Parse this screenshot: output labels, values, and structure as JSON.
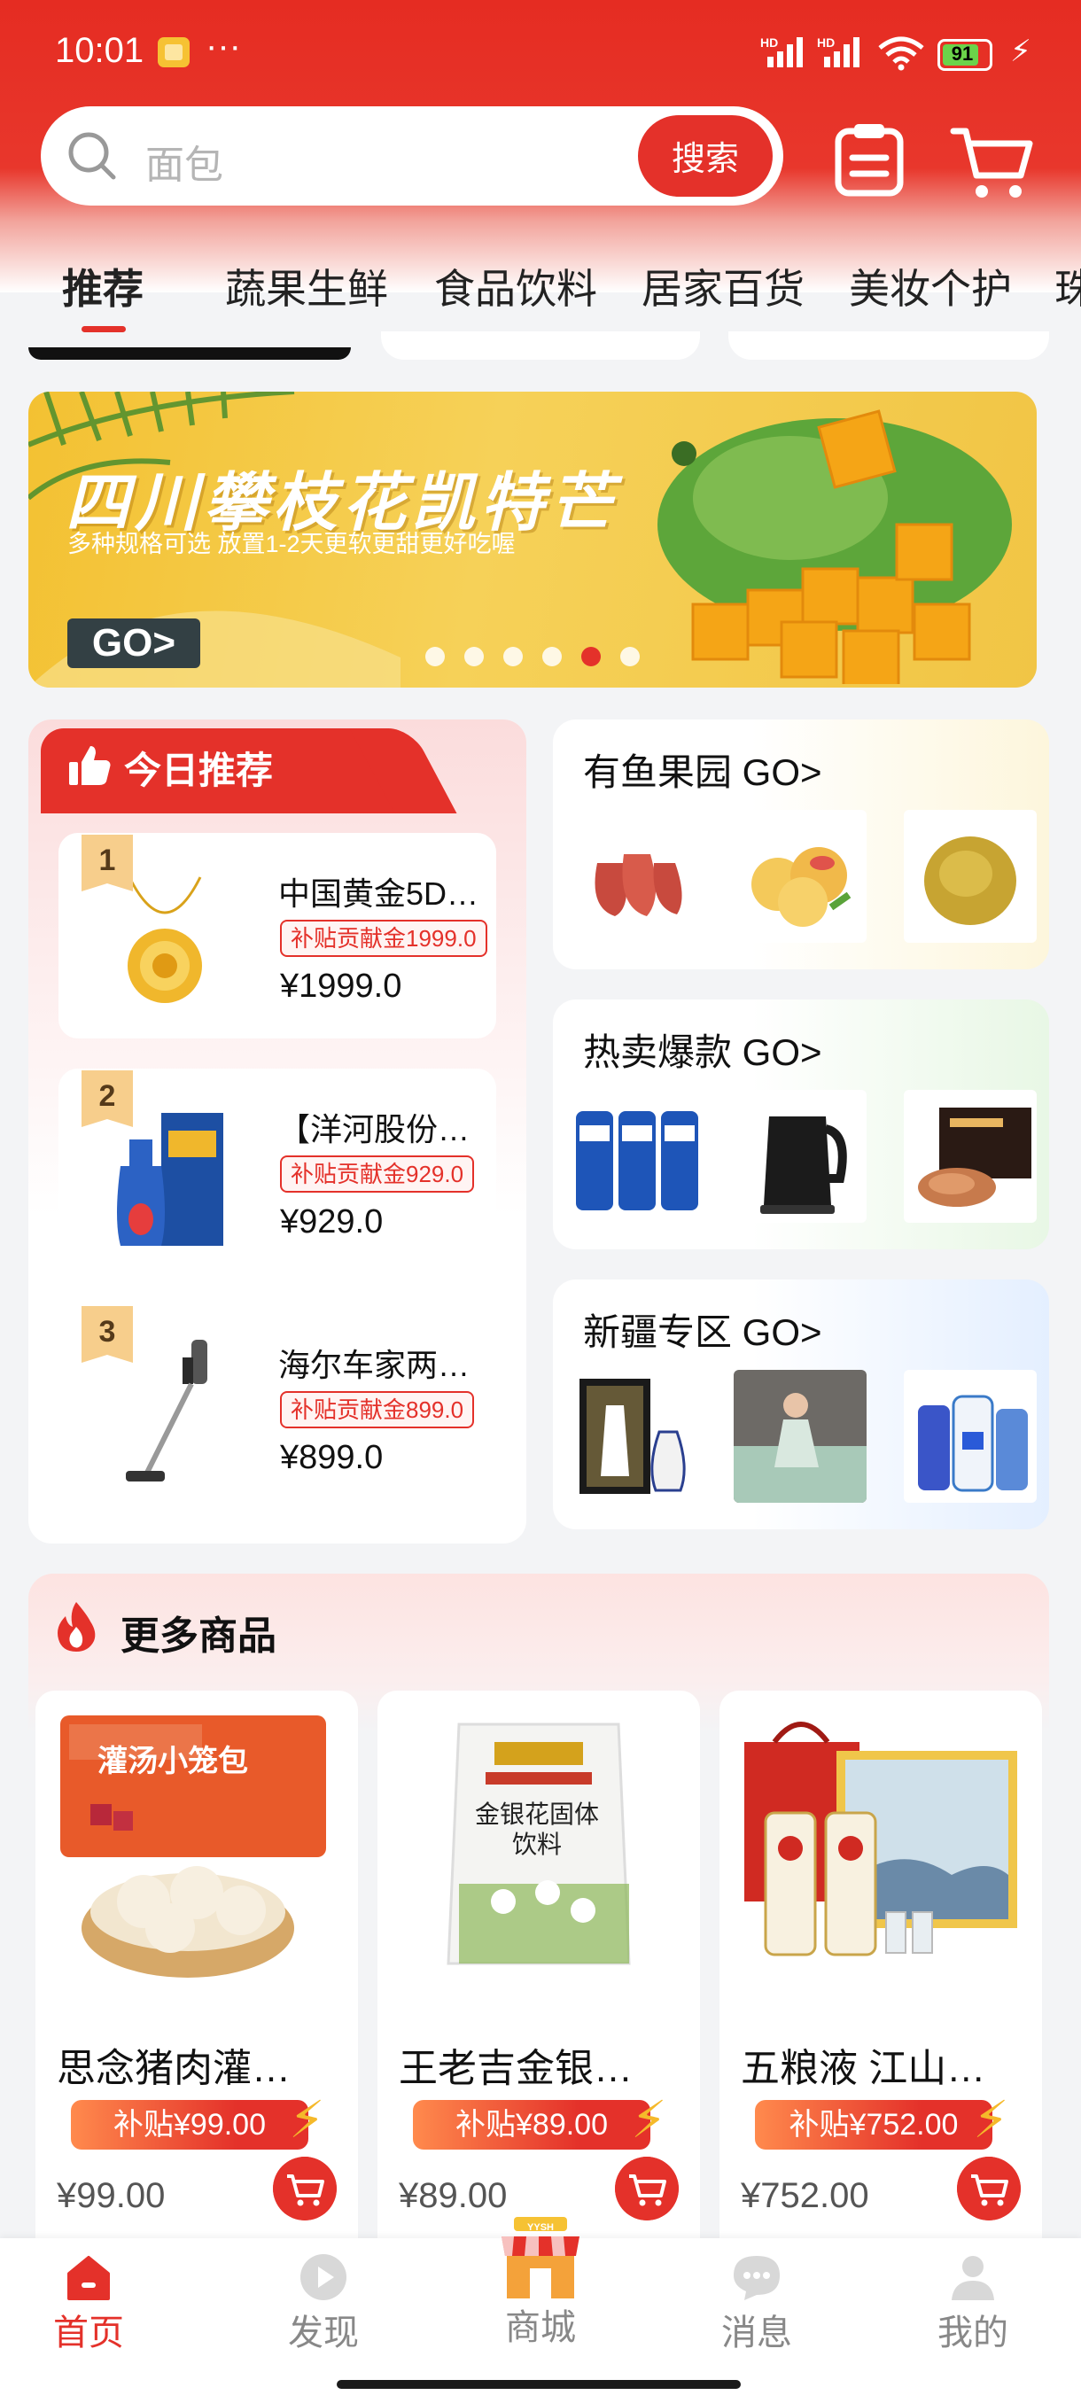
{
  "status_bar": {
    "time": "10:01",
    "dots": "···",
    "hd1": "HD",
    "hd2": "HD",
    "battery": "91"
  },
  "search": {
    "placeholder": "面包",
    "button_label": "搜索"
  },
  "categories": [
    "推荐",
    "蔬果生鲜",
    "食品饮料",
    "居家百货",
    "美妆个护",
    "珠"
  ],
  "banner": {
    "title": "四川攀枝花凯特芒",
    "subtitle": "多种规格可选 放置1-2天更软更甜更好吃喔",
    "go_label": "GO>",
    "slide_count": 6,
    "active_slide": 5
  },
  "today": {
    "title": "今日推荐",
    "items": [
      {
        "rank": "1",
        "name": "中国黄金5D…",
        "tag": "补贴贡献金1999.0",
        "price": "¥1999.0"
      },
      {
        "rank": "2",
        "name": "【洋河股份…",
        "tag": "补贴贡献金929.0",
        "price": "¥929.0"
      },
      {
        "rank": "3",
        "name": "海尔车家两…",
        "tag": "补贴贡献金899.0",
        "price": "¥899.0"
      }
    ]
  },
  "zones": [
    {
      "title": "有鱼果园 GO>"
    },
    {
      "title": "热卖爆款 GO>"
    },
    {
      "title": "新疆专区 GO>"
    }
  ],
  "more": {
    "title": "更多商品",
    "products": [
      {
        "name": "思念猪肉灌…",
        "subsidy": "补贴¥99.00",
        "price": "¥99.00",
        "pkg_text": "灌汤小笼包"
      },
      {
        "name": "王老吉金银…",
        "subsidy": "补贴¥89.00",
        "price": "¥89.00",
        "pkg_text": "金银花固体饮料"
      },
      {
        "name": "五粮液 江山…",
        "subsidy": "补贴¥752.00",
        "price": "¥752.00",
        "pkg_text": ""
      }
    ]
  },
  "nav": {
    "items": [
      {
        "label": "首页",
        "icon": "home-icon"
      },
      {
        "label": "发现",
        "icon": "discover-icon"
      },
      {
        "label": "商城",
        "icon": "mall-icon",
        "badge": "YYSH"
      },
      {
        "label": "消息",
        "icon": "message-icon"
      },
      {
        "label": "我的",
        "icon": "profile-icon"
      }
    ],
    "active": "首页"
  },
  "colors": {
    "brand_red": "#e4312a",
    "gold": "#f7ce8c",
    "battery_green": "#6bd34a"
  }
}
